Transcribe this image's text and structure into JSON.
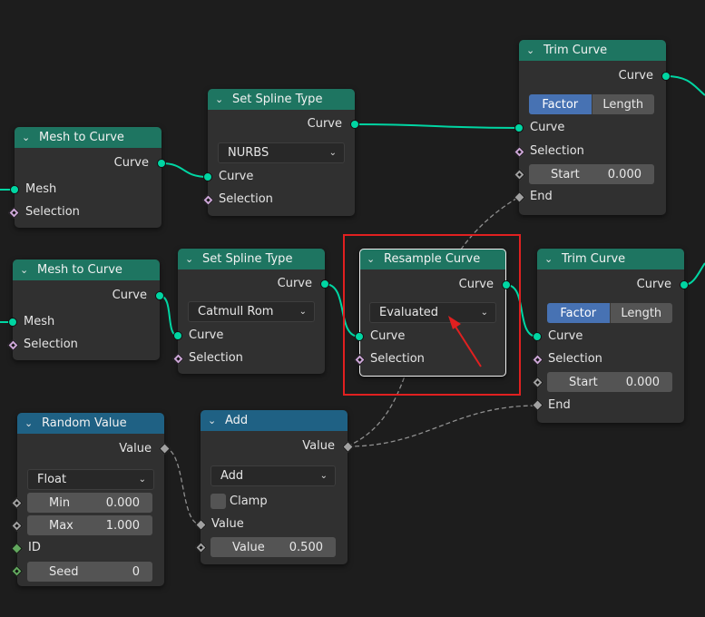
{
  "colors": {
    "background": "#1d1d1d",
    "node_body": "#303030",
    "geometry_header": "#1e7561",
    "utility_header": "#1f6184",
    "geometry_socket": "#00d6a3",
    "selection_socket": "#cca6d6",
    "float_socket": "#a1a1a1",
    "int_socket": "#62a85e",
    "active_option": "#4772b3",
    "annotation": "#e02020"
  },
  "icons": {
    "collapse": "chevron-down-icon",
    "dropdown": "chevron-down-icon"
  },
  "nodes": {
    "mesh_to_curve_1": {
      "title": "Mesh to Curve",
      "out_curve": "Curve",
      "in_mesh": "Mesh",
      "in_selection": "Selection"
    },
    "set_spline_type_1": {
      "title": "Set Spline Type",
      "out_curve": "Curve",
      "spline_type": "NURBS",
      "in_curve": "Curve",
      "in_selection": "Selection"
    },
    "trim_curve_1": {
      "title": "Trim Curve",
      "out_curve": "Curve",
      "mode_factor": "Factor",
      "mode_length": "Length",
      "in_curve": "Curve",
      "in_selection": "Selection",
      "start_label": "Start",
      "start_value": "0.000",
      "in_end": "End"
    },
    "mesh_to_curve_2": {
      "title": "Mesh to Curve",
      "out_curve": "Curve",
      "in_mesh": "Mesh",
      "in_selection": "Selection"
    },
    "set_spline_type_2": {
      "title": "Set Spline Type",
      "out_curve": "Curve",
      "spline_type": "Catmull Rom",
      "in_curve": "Curve",
      "in_selection": "Selection"
    },
    "resample_curve": {
      "title": "Resample Curve",
      "out_curve": "Curve",
      "mode": "Evaluated",
      "in_curve": "Curve",
      "in_selection": "Selection"
    },
    "trim_curve_2": {
      "title": "Trim Curve",
      "out_curve": "Curve",
      "mode_factor": "Factor",
      "mode_length": "Length",
      "in_curve": "Curve",
      "in_selection": "Selection",
      "start_label": "Start",
      "start_value": "0.000",
      "in_end": "End"
    },
    "random_value": {
      "title": "Random Value",
      "out_value": "Value",
      "data_type": "Float",
      "min_label": "Min",
      "min_value": "0.000",
      "max_label": "Max",
      "max_value": "1.000",
      "in_id": "ID",
      "seed_label": "Seed",
      "seed_value": "0"
    },
    "add": {
      "title": "Add",
      "out_value": "Value",
      "operation": "Add",
      "clamp_label": "Clamp",
      "in_value": "Value",
      "value_label": "Value",
      "value_value": "0.500"
    }
  }
}
